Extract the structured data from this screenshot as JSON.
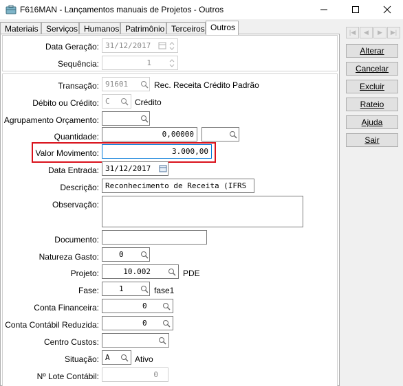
{
  "window": {
    "title": "F616MAN - Lançamentos manuais de Projetos - Outros"
  },
  "tabs": [
    "Materiais",
    "Serviços",
    "Humanos",
    "Patrimônio",
    "Terceiros",
    "Outros"
  ],
  "active_tab": "Outros",
  "header": {
    "data_geracao_label": "Data Geração:",
    "data_geracao_value": "31/12/2017",
    "sequencia_label": "Sequência:",
    "sequencia_value": "1"
  },
  "form": {
    "transacao_label": "Transação:",
    "transacao_value": "91601",
    "transacao_desc": "Rec. Receita Crédito Padrão",
    "debito_label": "Débito ou Crédito:",
    "debito_value": "C",
    "debito_desc": "Crédito",
    "agrupamento_label": "Agrupamento Orçamento:",
    "agrupamento_value": "",
    "quantidade_label": "Quantidade:",
    "quantidade_value": "0,00000",
    "unidade_value": "",
    "valor_label": "Valor Movimento:",
    "valor_value": "3.000,00",
    "data_entrada_label": "Data Entrada:",
    "data_entrada_value": "31/12/2017",
    "descricao_label": "Descrição:",
    "descricao_value": "Reconhecimento de Receita (IFRS",
    "observacao_label": "Observação:",
    "observacao_value": "",
    "documento_label": "Documento:",
    "documento_value": "",
    "natureza_label": "Natureza Gasto:",
    "natureza_value": "0",
    "projeto_label": "Projeto:",
    "projeto_value": "10.002",
    "projeto_desc": "PDE",
    "fase_label": "Fase:",
    "fase_value": "1",
    "fase_desc": "fase1",
    "conta_fin_label": "Conta Financeira:",
    "conta_fin_value": "0",
    "conta_cont_label": "Conta Contábil Reduzida:",
    "conta_cont_value": "0",
    "centro_label": "Centro Custos:",
    "centro_value": "",
    "situacao_label": "Situação:",
    "situacao_value": "A",
    "situacao_desc": "Ativo",
    "lote_label": "Nº Lote Contábil:",
    "lote_value": "0"
  },
  "actions": [
    "Alterar",
    "Cancelar",
    "Excluir",
    "Rateio",
    "Ajuda",
    "Sair"
  ],
  "colors": {
    "highlight": "#d9111b",
    "accent": "#0078d7"
  }
}
